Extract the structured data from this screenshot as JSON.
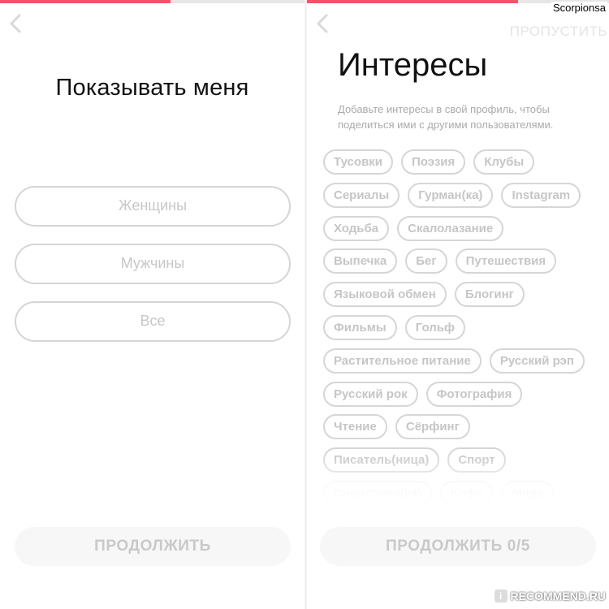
{
  "accent_color": "#f2546a",
  "left_screen": {
    "progress": 0.56,
    "title": "Показывать меня",
    "options": [
      {
        "label": "Женщины"
      },
      {
        "label": "Мужчины"
      },
      {
        "label": "Все"
      }
    ],
    "continue_label": "ПРОДОЛЖИТЬ"
  },
  "right_screen": {
    "progress": 0.7,
    "skip_label": "ПРОПУСТИТЬ",
    "title": "Интересы",
    "description": "Добавьте интересы в свой профиль, чтобы поделиться ими с другими пользователями.",
    "interest_rows": [
      [
        "Тусовки",
        "Поэзия",
        "Клубы"
      ],
      [
        "Сериалы",
        "Гурман(ка)",
        "Instagram"
      ],
      [
        "Ходьба",
        "Скалолазание"
      ],
      [
        "Выпечка",
        "Бег",
        "Путешествия"
      ],
      [
        "Языковой обмен",
        "Блогинг"
      ],
      [
        "Фильмы",
        "Гольф"
      ],
      [
        "Растительное питание",
        "Русский рэп"
      ],
      [
        "Русский рок",
        "Фотография"
      ],
      [
        "Чтение",
        "Сёрфинг"
      ],
      [
        "Писатель(ница)",
        "Спорт"
      ],
      [
        "Спортсмен(ка)",
        "Кофе",
        "Мода"
      ]
    ],
    "continue_label": "ПРОДОЛЖИТЬ 0/5"
  },
  "overlay": {
    "username": "Scorpionsa",
    "watermark": "RECOMMEND.RU",
    "watermark_badge": "i"
  }
}
